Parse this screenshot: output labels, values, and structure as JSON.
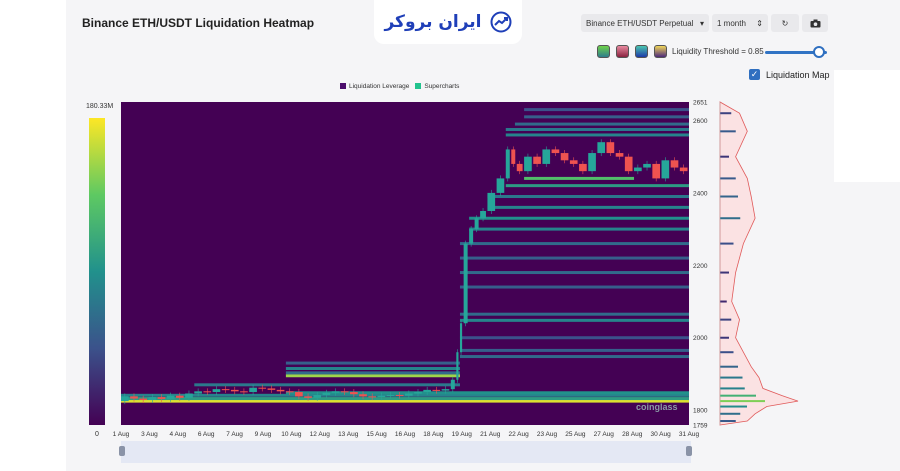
{
  "app": {
    "title": "Binance ETH/USDT Liquidation Heatmap",
    "logo_text": "ایران بروکر"
  },
  "controls": {
    "pair": "Binance ETH/USDT Perpetual",
    "range": "1 month",
    "threshold_label": "Liquidity Threshold = 0.85",
    "threshold_value": 0.85,
    "liquidation_map_label": "Liquidation Map",
    "liquidation_map_checked": true,
    "color_schemes": [
      "green-red",
      "red-pink",
      "blue-green",
      "purple-yellow"
    ]
  },
  "colors": {
    "background": "#440154",
    "candle_up": "#26a69a",
    "candle_down": "#ef5350",
    "hot": "#fde725",
    "legend_leverage": "#4b0c6b",
    "legend_supercharts": "#22c38e"
  },
  "chart_data": {
    "type": "heatmap",
    "legend": [
      {
        "label": "Liquidation Leverage"
      },
      {
        "label": "Supercharts"
      }
    ],
    "color_scale": {
      "min_label": "0",
      "max_label": "180.33M"
    },
    "x_ticks": [
      "1 Aug",
      "3 Aug",
      "4 Aug",
      "6 Aug",
      "7 Aug",
      "9 Aug",
      "10 Aug",
      "12 Aug",
      "13 Aug",
      "15 Aug",
      "16 Aug",
      "18 Aug",
      "19 Aug",
      "21 Aug",
      "22 Aug",
      "23 Aug",
      "25 Aug",
      "27 Aug",
      "28 Aug",
      "30 Aug",
      "31 Aug"
    ],
    "y_ticks": [
      2651,
      2600,
      2400,
      2200,
      2000,
      1800,
      1759
    ],
    "ylim": [
      1759,
      2651
    ],
    "xlim": [
      0,
      31
    ],
    "price": [
      [
        0,
        1825
      ],
      [
        0.5,
        1838
      ],
      [
        1,
        1832
      ],
      [
        1.5,
        1828
      ],
      [
        2,
        1836
      ],
      [
        2.5,
        1831
      ],
      [
        3,
        1840
      ],
      [
        3.5,
        1834
      ],
      [
        4,
        1846
      ],
      [
        4.5,
        1852
      ],
      [
        5,
        1850
      ],
      [
        5.5,
        1858
      ],
      [
        6,
        1856
      ],
      [
        6.5,
        1852
      ],
      [
        7,
        1850
      ],
      [
        7.5,
        1862
      ],
      [
        8,
        1860
      ],
      [
        8.5,
        1856
      ],
      [
        9,
        1852
      ],
      [
        9.5,
        1850
      ],
      [
        10,
        1838
      ],
      [
        10.5,
        1834
      ],
      [
        11,
        1842
      ],
      [
        11.5,
        1848
      ],
      [
        12,
        1852
      ],
      [
        12.5,
        1850
      ],
      [
        13,
        1844
      ],
      [
        13.5,
        1838
      ],
      [
        14,
        1836
      ],
      [
        14.5,
        1840
      ],
      [
        15,
        1842
      ],
      [
        15.5,
        1840
      ],
      [
        16,
        1846
      ],
      [
        16.5,
        1850
      ],
      [
        17,
        1856
      ],
      [
        17.5,
        1854
      ],
      [
        18,
        1858
      ],
      [
        18.3,
        1884
      ],
      [
        18.5,
        1960
      ],
      [
        18.7,
        2040
      ],
      [
        19,
        2260
      ],
      [
        19.3,
        2300
      ],
      [
        19.6,
        2330
      ],
      [
        20,
        2350
      ],
      [
        20.5,
        2400
      ],
      [
        21,
        2440
      ],
      [
        21.3,
        2520
      ],
      [
        21.6,
        2480
      ],
      [
        22,
        2460
      ],
      [
        22.5,
        2500
      ],
      [
        23,
        2480
      ],
      [
        23.5,
        2520
      ],
      [
        24,
        2510
      ],
      [
        24.5,
        2490
      ],
      [
        25,
        2480
      ],
      [
        25.5,
        2460
      ],
      [
        26,
        2510
      ],
      [
        26.5,
        2540
      ],
      [
        27,
        2510
      ],
      [
        27.5,
        2500
      ],
      [
        28,
        2460
      ],
      [
        28.5,
        2470
      ],
      [
        29,
        2480
      ],
      [
        29.5,
        2440
      ],
      [
        30,
        2490
      ],
      [
        30.5,
        2470
      ],
      [
        31,
        2460
      ]
    ],
    "bands": [
      {
        "price": 1825,
        "intensity": 0.95,
        "x0": 0,
        "x1": 31
      },
      {
        "price": 1832,
        "intensity": 0.55,
        "x0": 0,
        "x1": 31
      },
      {
        "price": 1841,
        "intensity": 0.45,
        "x0": 0,
        "x1": 31
      },
      {
        "price": 1848,
        "intensity": 0.5,
        "x0": 9,
        "x1": 31
      },
      {
        "price": 1870,
        "intensity": 0.4,
        "x0": 4,
        "x1": 18.5
      },
      {
        "price": 1895,
        "intensity": 0.85,
        "x0": 9,
        "x1": 18.5
      },
      {
        "price": 1903,
        "intensity": 0.35,
        "x0": 9,
        "x1": 18.5
      },
      {
        "price": 1915,
        "intensity": 0.45,
        "x0": 9,
        "x1": 18.5
      },
      {
        "price": 1930,
        "intensity": 0.3,
        "x0": 9,
        "x1": 18.5
      },
      {
        "price": 1948,
        "intensity": 0.35,
        "x0": 18.5,
        "x1": 31
      },
      {
        "price": 1965,
        "intensity": 0.3,
        "x0": 18.5,
        "x1": 31
      },
      {
        "price": 2000,
        "intensity": 0.25,
        "x0": 18.5,
        "x1": 31
      },
      {
        "price": 2048,
        "intensity": 0.45,
        "x0": 18.5,
        "x1": 31
      },
      {
        "price": 2065,
        "intensity": 0.35,
        "x0": 18.5,
        "x1": 31
      },
      {
        "price": 2140,
        "intensity": 0.3,
        "x0": 18.5,
        "x1": 31
      },
      {
        "price": 2180,
        "intensity": 0.35,
        "x0": 18.5,
        "x1": 31
      },
      {
        "price": 2220,
        "intensity": 0.3,
        "x0": 18.5,
        "x1": 31
      },
      {
        "price": 2260,
        "intensity": 0.35,
        "x0": 18.5,
        "x1": 31
      },
      {
        "price": 2300,
        "intensity": 0.45,
        "x0": 19,
        "x1": 31
      },
      {
        "price": 2330,
        "intensity": 0.5,
        "x0": 19,
        "x1": 31
      },
      {
        "price": 2360,
        "intensity": 0.45,
        "x0": 20,
        "x1": 31
      },
      {
        "price": 2390,
        "intensity": 0.4,
        "x0": 20,
        "x1": 31
      },
      {
        "price": 2420,
        "intensity": 0.55,
        "x0": 21,
        "x1": 31
      },
      {
        "price": 2440,
        "intensity": 0.7,
        "x0": 22,
        "x1": 28
      },
      {
        "price": 2560,
        "intensity": 0.45,
        "x0": 21,
        "x1": 31
      },
      {
        "price": 2575,
        "intensity": 0.4,
        "x0": 21,
        "x1": 31
      },
      {
        "price": 2590,
        "intensity": 0.35,
        "x0": 21.5,
        "x1": 31
      },
      {
        "price": 2610,
        "intensity": 0.3,
        "x0": 22,
        "x1": 31
      },
      {
        "price": 2630,
        "intensity": 0.25,
        "x0": 22,
        "x1": 31
      }
    ],
    "profile": [
      {
        "price": 1770,
        "value": 0.35
      },
      {
        "price": 1790,
        "value": 0.45
      },
      {
        "price": 1810,
        "value": 0.6
      },
      {
        "price": 1825,
        "value": 1.0
      },
      {
        "price": 1840,
        "value": 0.8
      },
      {
        "price": 1860,
        "value": 0.55
      },
      {
        "price": 1890,
        "value": 0.5
      },
      {
        "price": 1920,
        "value": 0.4
      },
      {
        "price": 1960,
        "value": 0.3
      },
      {
        "price": 2000,
        "value": 0.2
      },
      {
        "price": 2050,
        "value": 0.25
      },
      {
        "price": 2100,
        "value": 0.15
      },
      {
        "price": 2180,
        "value": 0.2
      },
      {
        "price": 2260,
        "value": 0.3
      },
      {
        "price": 2330,
        "value": 0.45
      },
      {
        "price": 2390,
        "value": 0.4
      },
      {
        "price": 2440,
        "value": 0.35
      },
      {
        "price": 2500,
        "value": 0.2
      },
      {
        "price": 2570,
        "value": 0.35
      },
      {
        "price": 2620,
        "value": 0.25
      }
    ],
    "watermark": "coinglass"
  }
}
